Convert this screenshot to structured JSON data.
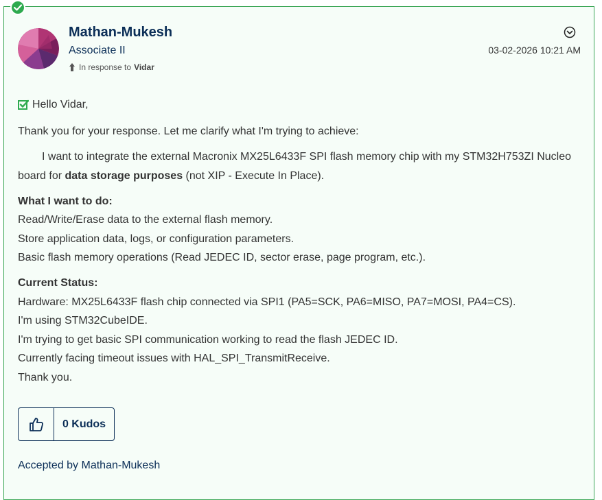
{
  "post": {
    "author": "Mathan-Mukesh",
    "rank": "Associate II",
    "in_response_prefix": "In response to",
    "in_response_user": "Vidar",
    "timestamp": "03-02-2026 10:21 AM",
    "greeting": "Hello Vidar,",
    "intro": "Thank you for your response. Let me clarify what I'm trying to achieve:",
    "goal_line1": "I want to integrate the external Macronix MX25L6433F SPI flash memory chip with my STM32H753ZI Nucleo",
    "goal_line2_pre": "board for ",
    "goal_line2_bold": "data storage purposes",
    "goal_line2_post": " (not XIP - Execute In Place).",
    "want_heading": "What I want to do:",
    "want_items": [
      "Read/Write/Erase data to the external flash memory.",
      "Store application data, logs, or configuration parameters.",
      "Basic flash memory operations (Read JEDEC ID, sector erase, page program, etc.)."
    ],
    "status_heading": "Current Status:",
    "status_items": [
      "Hardware: MX25L6433F flash chip connected via SPI1 (PA5=SCK, PA6=MISO, PA7=MOSI, PA4=CS).",
      "I'm using STM32CubeIDE.",
      "I'm trying to get basic SPI communication working to read the flash JEDEC ID.",
      "Currently facing timeout issues with HAL_SPI_TransmitReceive.",
      "Thank you."
    ],
    "kudos_label": "0 Kudos",
    "accepted_by": "Accepted by Mathan-Mukesh"
  },
  "colors": {
    "accent_green": "#2eaa4f",
    "border_green": "#3aa655",
    "navy": "#0b2e57"
  },
  "icons": [
    "check-badge-icon",
    "avatar",
    "reply-arrow-icon",
    "options-chevron-icon",
    "accepted-check-icon",
    "thumbs-up-icon"
  ]
}
